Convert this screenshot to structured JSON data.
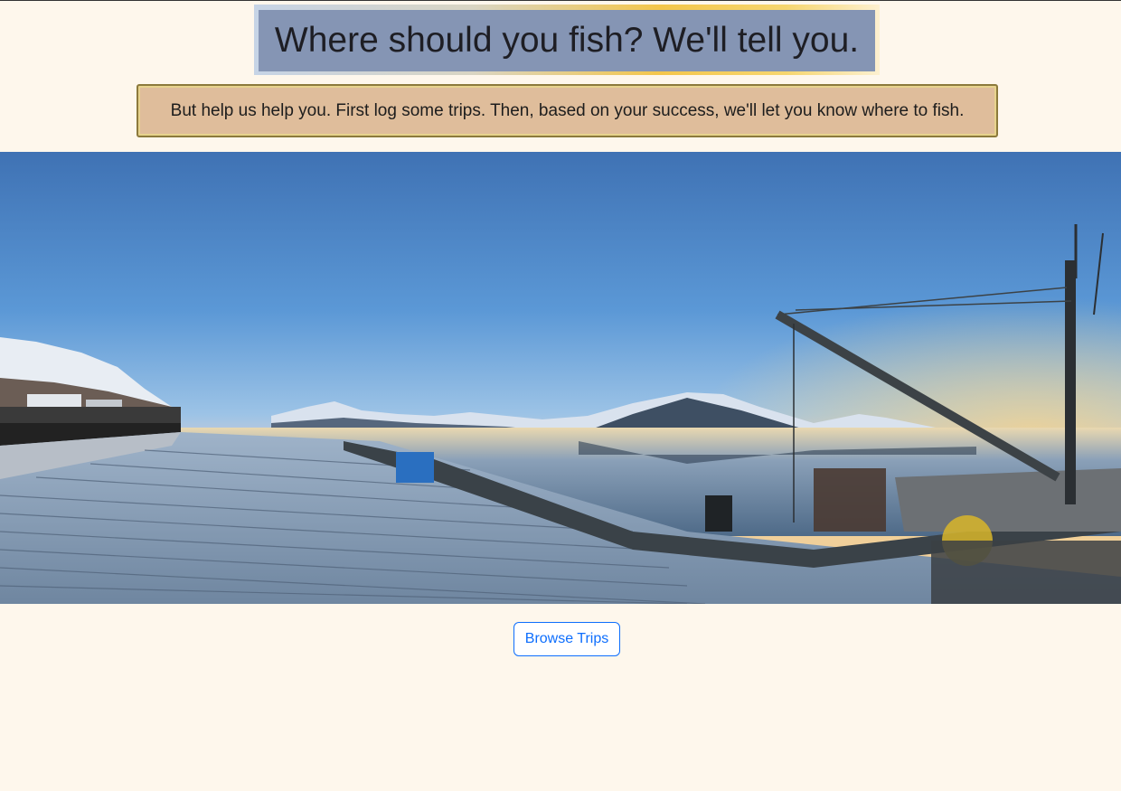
{
  "header": {
    "title": "Where should you fish? We'll tell you.",
    "subtitle": "But help us help you. First log some trips. Then, based on your success, we'll let you know where to fish."
  },
  "hero": {
    "description_icon": "harbor-dock-panorama"
  },
  "actions": {
    "browse_label": "Browse Trips"
  },
  "colors": {
    "page_background": "#fef7ec",
    "title_background": "#8595b4",
    "subtitle_background": "#dfbd9b",
    "button_accent": "#0d6efd"
  }
}
